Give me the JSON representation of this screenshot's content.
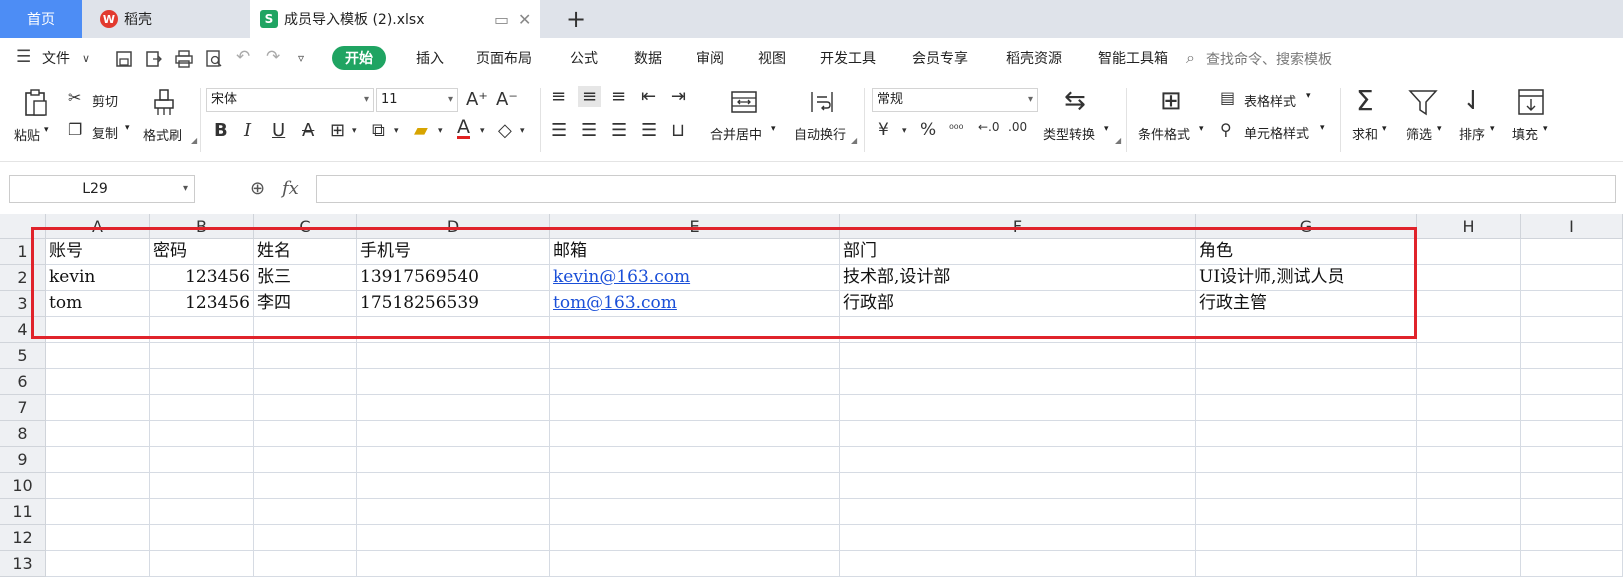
{
  "tabs": {
    "home": "首页",
    "daoke": "稻壳",
    "file": "成员导入模板 (2).xlsx",
    "new_tab": "+"
  },
  "menu": {
    "file": "文件",
    "items": [
      "开始",
      "插入",
      "页面布局",
      "公式",
      "数据",
      "审阅",
      "视图",
      "开发工具",
      "会员专享",
      "稻壳资源",
      "智能工具箱"
    ],
    "search": "查找命令、搜索模板"
  },
  "ribbon": {
    "paste": "粘贴",
    "cut": "剪切",
    "copy": "复制",
    "format_painter": "格式刷",
    "font_name": "宋体",
    "font_size": "11",
    "merge": "合并居中",
    "wrap": "自动换行",
    "number_format": "常规",
    "type_convert": "类型转换",
    "cond_format": "条件格式",
    "table_style": "表格样式",
    "cell_style": "单元格样式",
    "sum": "求和",
    "filter": "筛选",
    "sort": "排序",
    "fill": "填充"
  },
  "formula_bar": {
    "cell_ref": "L29",
    "fx": "fx",
    "value": ""
  },
  "sheet": {
    "columns": [
      "A",
      "B",
      "C",
      "D",
      "E",
      "F",
      "G",
      "H",
      "I"
    ],
    "rows": [
      "1",
      "2",
      "3",
      "4",
      "5",
      "6",
      "7",
      "8",
      "9",
      "10",
      "11",
      "12",
      "13"
    ],
    "cells": [
      [
        "账号",
        "密码",
        "姓名",
        "手机号",
        "邮箱",
        "部门",
        "角色"
      ],
      [
        "kevin",
        "123456",
        "张三",
        "13917569540",
        "kevin@163.com",
        "技术部,设计部",
        "UI设计师,测试人员"
      ],
      [
        "tom",
        "123456",
        "李四",
        "17518256539",
        "tom@163.com",
        "行政部",
        "行政主管"
      ]
    ]
  },
  "colors": {
    "accent": "#1fa462",
    "home_tab": "#4d8df5",
    "highlight": "#e0232b",
    "link": "#1a4fd8"
  }
}
